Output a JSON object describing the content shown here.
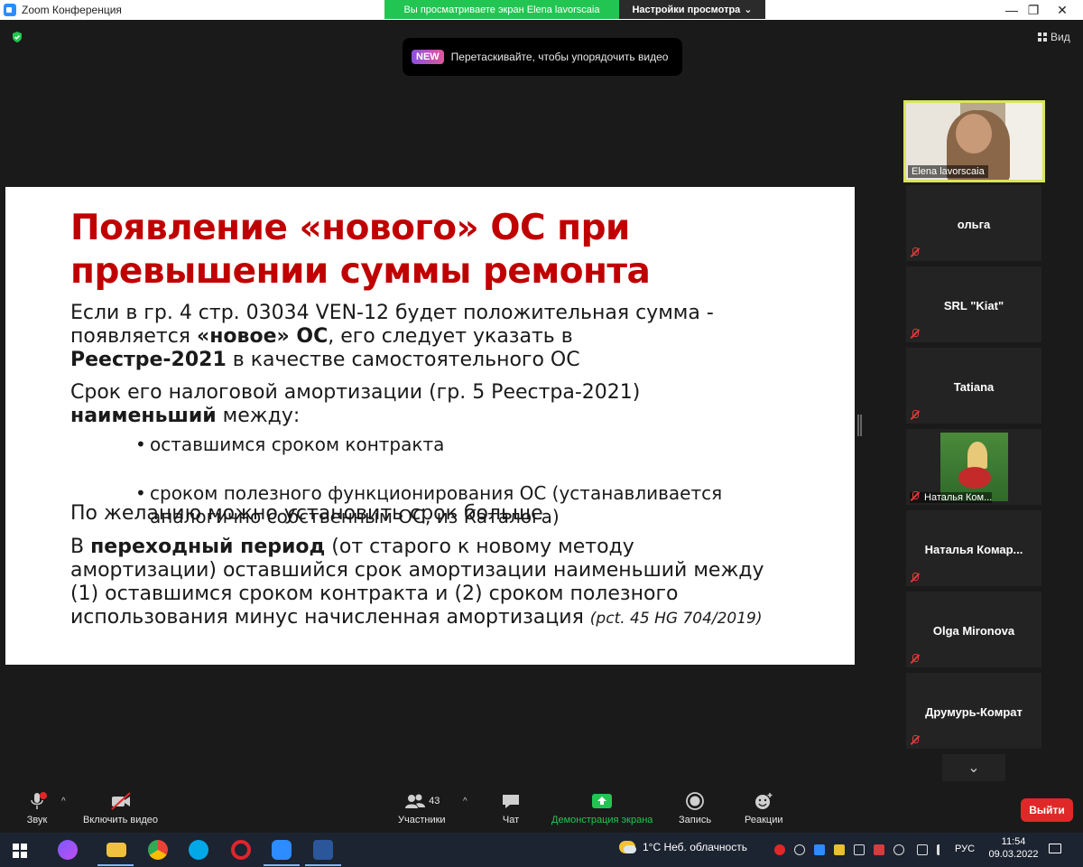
{
  "window": {
    "title": "Zoom Конференция",
    "share_banner": "Вы просматриваете экран Elena lavorscaia",
    "view_settings": "Настройки просмотра",
    "view_button": "Вид"
  },
  "hint": {
    "badge": "NEW",
    "text": "Перетаскивайте, чтобы упорядочить видео"
  },
  "slide": {
    "title": "Появление «нового» ОС при превышении суммы ремонта",
    "p1_a": "Если в гр. 4 стр. 03034 VEN-12 будет положительная сумма - появляется ",
    "p1_b": "«новое» ОС",
    "p1_c": ", его следует указать в ",
    "p1_d": "Реестре-2021",
    "p1_e": " в качестве самостоятельного ОС",
    "p2_a": "Срок его налоговой амортизации (гр. 5 Реестра-2021) ",
    "p2_b": "наименьший",
    "p2_c": " между:",
    "bullet1": "оставшимся сроком контракта",
    "bullet2": "сроком полезного функционирования ОС (устанавливается аналогично собственным ОС, из Каталога)",
    "p3": "По желанию можно установить срок больше",
    "p4_a": "В ",
    "p4_b": "переходный период",
    "p4_c": " (от старого к новому методу амортизации) оставшийся срок амортизации наименьший между (1) оставшимся сроком контракта и (2) сроком полезного использования минус начисленная амортизация ",
    "p4_d": "(pct. 45 HG 704/2019)"
  },
  "participants": {
    "active": "Elena lavorscaia",
    "tiles": [
      "ольга",
      "SRL \"Kiat\"",
      "Tatiana",
      "Наталья Ком...",
      "Наталья  Комар...",
      "Olga Mironova",
      "Друмурь-Комрат"
    ]
  },
  "toolbar": {
    "audio": "Звук",
    "video": "Включить видео",
    "participants": "Участники",
    "participants_count": "43",
    "chat": "Чат",
    "share": "Демонстрация экрана",
    "record": "Запись",
    "reactions": "Реакции",
    "leave": "Выйти"
  },
  "taskbar": {
    "weather": "1°C  Неб. облачность",
    "lang": "РУС",
    "time": "11:54",
    "date": "09.03.2022"
  },
  "colors": {
    "accent_green": "#23c552",
    "slide_title": "#c00000",
    "leave_red": "#e02828",
    "active_border": "#d9e65a"
  }
}
